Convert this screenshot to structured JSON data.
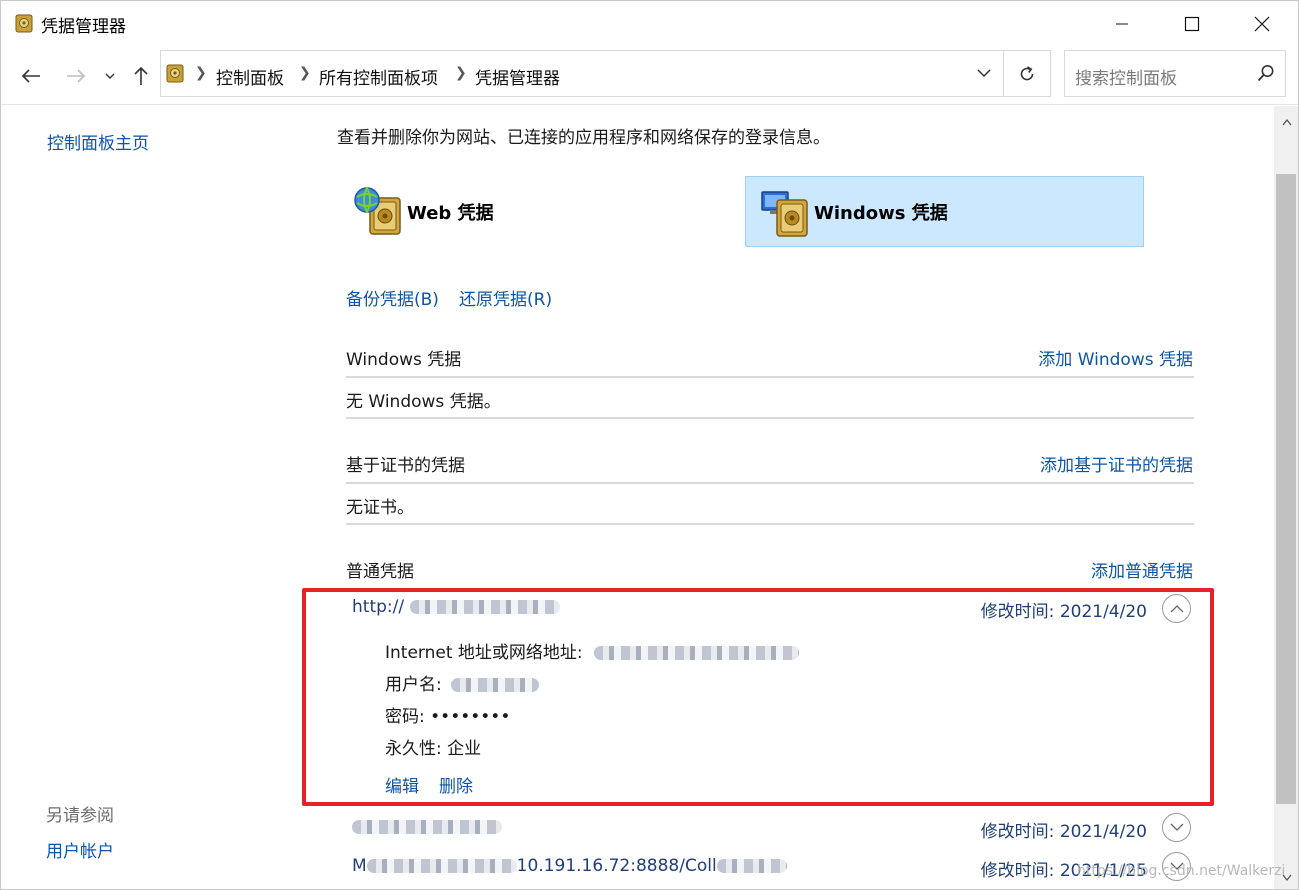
{
  "window": {
    "title": "凭据管理器"
  },
  "nav": {
    "breadcrumb": [
      "控制面板",
      "所有控制面板项",
      "凭据管理器"
    ],
    "search_placeholder": "搜索控制面板"
  },
  "left": {
    "home_link": "控制面板主页",
    "see_also_label": "另请参阅",
    "user_accounts_link": "用户帐户"
  },
  "main": {
    "intro": "查看并删除你为网站、已连接的应用程序和网络保存的登录信息。",
    "cred_types": {
      "web": "Web 凭据",
      "windows": "Windows 凭据"
    },
    "backup_link": "备份凭据(B)",
    "restore_link": "还原凭据(R)",
    "sections": {
      "windows": {
        "title": "Windows 凭据",
        "action": "添加 Windows 凭据",
        "empty": "无 Windows 凭据。"
      },
      "cert": {
        "title": "基于证书的凭据",
        "action": "添加基于证书的凭据",
        "empty": "无证书。"
      },
      "generic": {
        "title": "普通凭据",
        "action": "添加普通凭据"
      }
    },
    "entries": [
      {
        "name": "http://",
        "modified": "修改时间:  2021/4/20"
      },
      {
        "name": "",
        "modified": "修改时间:  2021/4/20"
      },
      {
        "name": "M",
        "name_tail": "10.191.16.72:8888/Coll",
        "modified": "修改时间:  2021/1/25"
      }
    ],
    "details": {
      "address_label": "Internet 地址或网络地址:",
      "username_label": "用户名:",
      "password_label": "密码:",
      "password_value": "••••••••",
      "persistence_label": "永久性:",
      "persistence_value": "企业",
      "edit_link": "编辑",
      "delete_link": "删除"
    }
  },
  "watermark": "https://blog.csdn.net/Walkerzi"
}
